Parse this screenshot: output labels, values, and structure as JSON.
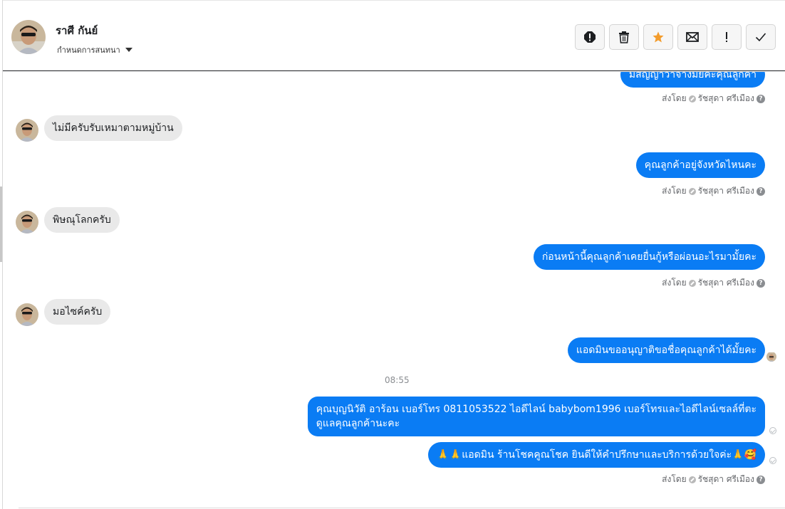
{
  "header": {
    "contact_name": "ราศี กันย์",
    "conversation_status": "กำหนดการสนทนา",
    "actions": [
      {
        "name": "alert-circle-icon",
        "title": "mark-spam"
      },
      {
        "name": "trash-icon",
        "title": "delete"
      },
      {
        "name": "star-icon",
        "title": "star"
      },
      {
        "name": "envelope-icon",
        "title": "mark-unread"
      },
      {
        "name": "exclamation-icon",
        "title": "follow-up"
      },
      {
        "name": "checkmark-icon",
        "title": "done"
      }
    ],
    "star_color": "#f39c2c"
  },
  "messages": [
    {
      "dir": "out",
      "text": "มีสัญญาว่าจ้างมั้ยคะคุณลูกค้า",
      "meta": "ส่งโดย",
      "agent": "รัชสุดา ศรีเมือง"
    },
    {
      "dir": "in",
      "text": "ไม่มีครับรับเหมาตามหมู่บ้าน"
    },
    {
      "dir": "out",
      "text": "คุณลูกค้าอยู่จังหวัดไหนคะ",
      "meta": "ส่งโดย",
      "agent": "รัชสุดา ศรีเมือง"
    },
    {
      "dir": "in",
      "text": "พิษณุโลกครับ"
    },
    {
      "dir": "out",
      "text": "ก่อนหน้านี้คุณลูกค้าเคยยื่นกู้หรือผ่อนอะไรมามั้ยคะ",
      "meta": "ส่งโดย",
      "agent": "รัชสุดา ศรีเมือง"
    },
    {
      "dir": "in",
      "text": "มอไซค์ครับ"
    },
    {
      "dir": "out",
      "text": "แอดมินขออนุญาติขอชื่อคุณลูกค้าได้มั้ยคะ"
    },
    {
      "dir": "time",
      "text": "08:55"
    },
    {
      "dir": "out",
      "line1": "คุณบุญนิวัติ  อาร้อน        เบอร์โทร 0811053522  ไอดีไลน์ babybom1996  เบอร์โทรและไอดีไลน์เซลล์ที่ตะ",
      "line2": "ดูแลคุณลูกค้านะคะ"
    },
    {
      "dir": "out",
      "text": "🙏🙏แอดมิน ร้านโชคคูณโชค ยินดีให้คำปรึกษาและบริการด้วยใจค่ะ🙏🥰",
      "meta": "ส่งโดย",
      "agent": "รัชสุดา ศรีเมือง"
    }
  ],
  "colors": {
    "outgoing": "#0a7cf4",
    "incoming": "#e9e9e9"
  }
}
